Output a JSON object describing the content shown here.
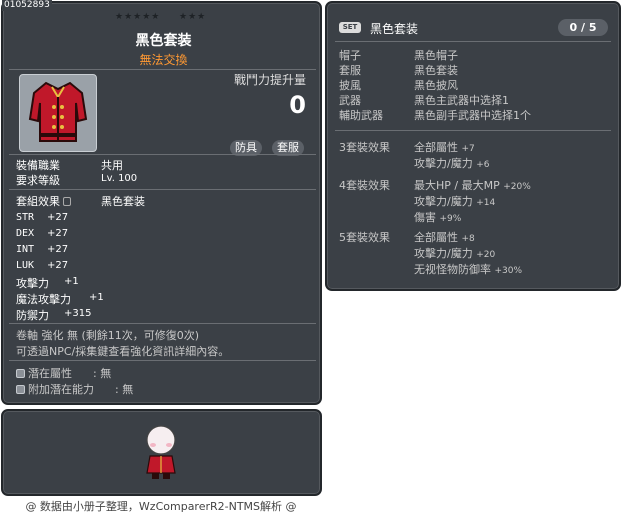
{
  "item": {
    "code": "01052893",
    "stars_left": "★★★★★",
    "stars_right": "★★★",
    "name": "黑色套装",
    "trade": "無法交換",
    "power_label": "戰鬥力提升量",
    "power_value": "0",
    "tags": [
      "防具",
      "套服"
    ],
    "job_label": "裝備職業",
    "job_value": "共用",
    "level_label": "要求等級",
    "level_value": "Lv. 100",
    "set_effect_label": "套組效果",
    "set_effect_value": "黑色套装",
    "stats": [
      {
        "name": "STR",
        "value": "+27"
      },
      {
        "name": "DEX",
        "value": "+27"
      },
      {
        "name": "INT",
        "value": "+27"
      },
      {
        "name": "LUK",
        "value": "+27"
      },
      {
        "name": "攻擊力",
        "value": "+1"
      },
      {
        "name": "魔法攻擊力",
        "value": "+1"
      },
      {
        "name": "防禦力",
        "value": "+315"
      }
    ],
    "scroll_line": "卷軸 強化 無 (剩餘11次，可修復0次)",
    "info_line": "可透過NPC/採集鍵查看強化資訊詳細內容。",
    "potential_label": "潛在屬性",
    "potential_value": ": 無",
    "bonus_potential_label": "附加潛在能力",
    "bonus_potential_value": ": 無"
  },
  "set": {
    "badge": "SET",
    "name": "黑色套装",
    "count": "0 / 5",
    "items": [
      {
        "slot": "帽子",
        "name": "黑色帽子"
      },
      {
        "slot": "套服",
        "name": "黑色套装"
      },
      {
        "slot": "披風",
        "name": "黑色披风"
      },
      {
        "slot": "武器",
        "name": "黑色主武器中选择1"
      },
      {
        "slot": "輔助武器",
        "name": "黑色副手武器中选择1个"
      }
    ],
    "effects": [
      {
        "label": "3套裝效果",
        "lines": [
          {
            "text": "全部屬性",
            "value": "+7"
          },
          {
            "text": "攻擊力/魔力",
            "value": "+6"
          }
        ]
      },
      {
        "label": "4套裝效果",
        "lines": [
          {
            "text": "最大HP / 最大MP",
            "value": "+20%"
          },
          {
            "text": "攻擊力/魔力",
            "value": "+14"
          },
          {
            "text": "傷害",
            "value": "+9%"
          }
        ]
      },
      {
        "label": "5套裝效果",
        "lines": [
          {
            "text": "全部屬性",
            "value": "+8"
          },
          {
            "text": "攻擊力/魔力",
            "value": "+20"
          },
          {
            "text": "无视怪物防御率",
            "value": "+30%"
          }
        ]
      }
    ]
  },
  "footer": "@ 数据由小册子整理，WzComparerR2-NTMS解析 @",
  "icons": {
    "item": "red-coat-icon",
    "lock": "lock-icon",
    "bullet": "potential-bullet-icon",
    "avatar": "character-avatar-icon"
  },
  "colors": {
    "panel": "#3b4046",
    "trade": "#ff9933",
    "coat_red": "#c0182a"
  }
}
